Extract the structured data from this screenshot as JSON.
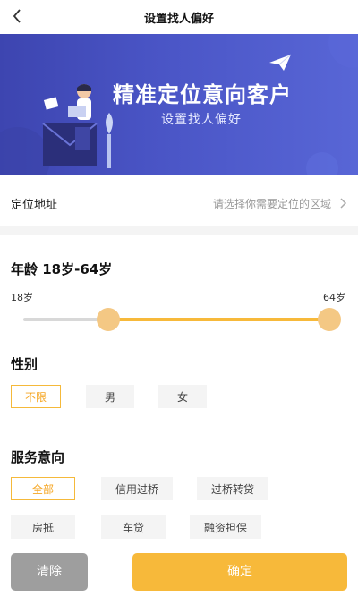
{
  "header": {
    "title": "设置找人偏好"
  },
  "banner": {
    "title": "精准定位意向客户",
    "subtitle": "设置找人偏好"
  },
  "address": {
    "label": "定位地址",
    "placeholder": "请选择你需要定位的区域"
  },
  "age": {
    "title": "年龄 18岁-64岁",
    "min_label": "18岁",
    "max_label": "64岁",
    "range_fraction": [
      0.27,
      1.0
    ]
  },
  "gender": {
    "title": "性别",
    "options": [
      "不限",
      "男",
      "女"
    ],
    "selected": "不限"
  },
  "service": {
    "title": "服务意向",
    "options": [
      "全部",
      "信用过桥",
      "过桥转贷",
      "房抵",
      "车贷",
      "融资担保"
    ],
    "selected": "全部"
  },
  "actions": {
    "clear": "清除",
    "confirm": "确定"
  },
  "colors": {
    "accent": "#f7b93a",
    "banner": "#4a55c6",
    "clear_button": "#9e9e9e"
  }
}
